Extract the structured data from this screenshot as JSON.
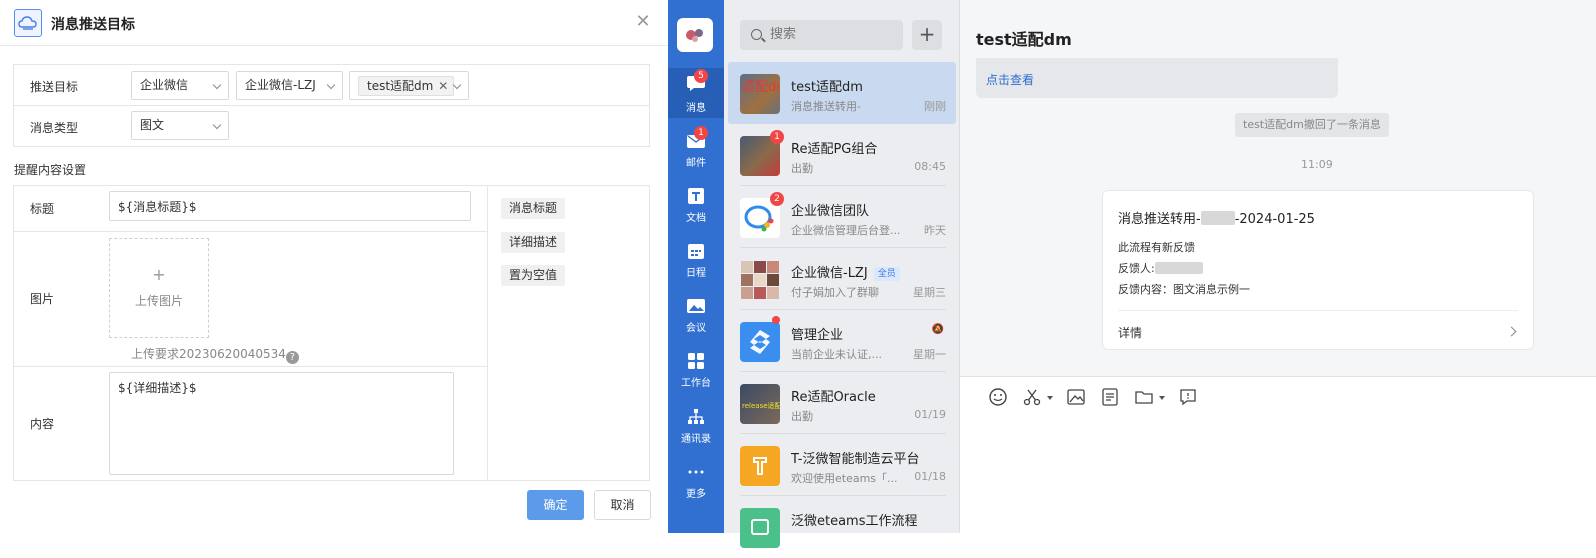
{
  "dialog": {
    "title": "消息推送目标",
    "push_target_label": "推送目标",
    "push_target_select1": "企业微信",
    "push_target_select2": "企业微信-LZJ",
    "push_target_tag": "test适配dm",
    "message_type_label": "消息类型",
    "message_type_value": "图文",
    "section_title": "提醒内容设置",
    "title_label": "标题",
    "title_value": "${消息标题}$",
    "image_label": "图片",
    "upload_plus": "+",
    "upload_text": "上传图片",
    "upload_requirement": "上传要求20230620040534",
    "content_label": "内容",
    "content_value": "${详细描述}$",
    "variables": [
      "消息标题",
      "详细描述",
      "置为空值"
    ],
    "ok_label": "确定",
    "cancel_label": "取消",
    "close_icon": "close-icon"
  },
  "nav": {
    "items": [
      {
        "label": "消息",
        "icon": "chat-icon",
        "badge": "5"
      },
      {
        "label": "邮件",
        "icon": "mail-icon",
        "badge": "1"
      },
      {
        "label": "文档",
        "icon": "doc-icon",
        "badge": ""
      },
      {
        "label": "日程",
        "icon": "calendar-icon",
        "badge": ""
      },
      {
        "label": "会议",
        "icon": "meeting-icon",
        "badge": ""
      },
      {
        "label": "工作台",
        "icon": "workbench-icon",
        "badge": ""
      },
      {
        "label": "通讯录",
        "icon": "contacts-icon",
        "badge": ""
      },
      {
        "label": "更多",
        "icon": "more-icon",
        "badge": ""
      }
    ]
  },
  "list": {
    "search_placeholder": "搜索",
    "plus": "+",
    "conversations": [
      {
        "name": "test适配dm",
        "preview": "消息推送转用-",
        "time": "刚刚",
        "badge": "",
        "tag": ""
      },
      {
        "name": "Re适配PG组合",
        "preview": "出勤",
        "time": "08:45",
        "badge": "1",
        "tag": ""
      },
      {
        "name": "企业微信团队",
        "preview": "企业微信管理后台登...",
        "time": "昨天",
        "badge": "2",
        "tag": ""
      },
      {
        "name": "企业微信-LZJ",
        "preview": "付子娟加入了群聊",
        "time": "星期三",
        "badge": "",
        "tag": "全员"
      },
      {
        "name": "管理企业",
        "preview": "当前企业未认证,...",
        "time": "星期一",
        "badge": "",
        "tag": ""
      },
      {
        "name": "Re适配Oracle",
        "preview": "出勤",
        "time": "01/19",
        "badge": "",
        "tag": ""
      },
      {
        "name": "T-泛微智能制造云平台",
        "preview": "欢迎使用eteams「...",
        "time": "01/18",
        "badge": "",
        "tag": ""
      },
      {
        "name": "泛微eteams工作流程",
        "preview": "",
        "time": "",
        "badge": "",
        "tag": ""
      }
    ],
    "avatar_texts": {
      "test_dm": "适配dm",
      "oracle": "release适配Oracle"
    }
  },
  "chat": {
    "title": "test适配dm",
    "prev_link": "点击查看",
    "system_message": "test适配dm撤回了一条消息",
    "time_divider": "11:09",
    "card": {
      "title_prefix": "消息推送转用-",
      "title_suffix": "-2024-01-25",
      "line1": "此流程有新反馈",
      "line2_label": "反馈人:",
      "line3": "反馈内容：图文消息示例一",
      "detail": "详情"
    }
  },
  "colors": {
    "nav_blue": "#3170d0",
    "accent": "#5b9bea",
    "badge_red": "#f24545",
    "link": "#2c6fd1"
  }
}
